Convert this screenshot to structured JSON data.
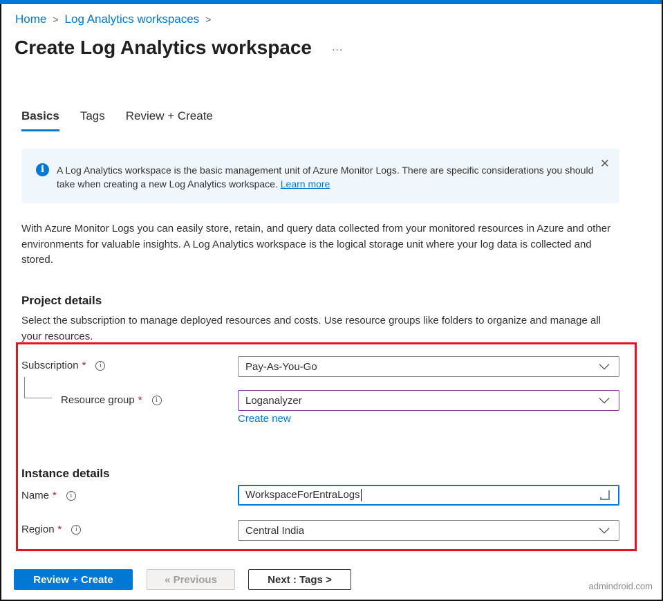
{
  "breadcrumb": {
    "items": [
      {
        "label": "Home"
      },
      {
        "label": "Log Analytics workspaces"
      }
    ],
    "separator": ">"
  },
  "page": {
    "title": "Create Log Analytics workspace",
    "more_icon": "..."
  },
  "tabs": [
    {
      "label": "Basics",
      "active": true
    },
    {
      "label": "Tags",
      "active": false
    },
    {
      "label": "Review + Create",
      "active": false
    }
  ],
  "info_banner": {
    "icon": "i",
    "text": "A Log Analytics workspace is the basic management unit of Azure Monitor Logs. There are specific considerations you should take when creating a new Log Analytics workspace.",
    "link_label": "Learn more",
    "close_icon": "✕"
  },
  "description": "With Azure Monitor Logs you can easily store, retain, and query data collected from your monitored resources in Azure and other environments for valuable insights. A Log Analytics workspace is the logical storage unit where your log data is collected and stored.",
  "project_details": {
    "title": "Project details",
    "description": "Select the subscription to manage deployed resources and costs. Use resource groups like folders to organize and manage all your resources.",
    "subscription": {
      "label": "Subscription",
      "required": "*",
      "help": "i",
      "value": "Pay-As-You-Go"
    },
    "resource_group": {
      "label": "Resource group",
      "required": "*",
      "help": "i",
      "value": "Loganalyzer",
      "create_new_label": "Create new"
    }
  },
  "instance_details": {
    "title": "Instance details",
    "name": {
      "label": "Name",
      "required": "*",
      "help": "i",
      "value": "WorkspaceForEntraLogs"
    },
    "region": {
      "label": "Region",
      "required": "*",
      "help": "i",
      "value": "Central India"
    }
  },
  "footer": {
    "review_create_label": "Review + Create",
    "previous_label": "« Previous",
    "next_label": "Next : Tags >"
  },
  "watermark": "admindroid.com",
  "colors": {
    "accent": "#0078d4",
    "highlight_border": "#e81123",
    "required": "#a4262c",
    "banner_bg": "#eff6fc"
  }
}
